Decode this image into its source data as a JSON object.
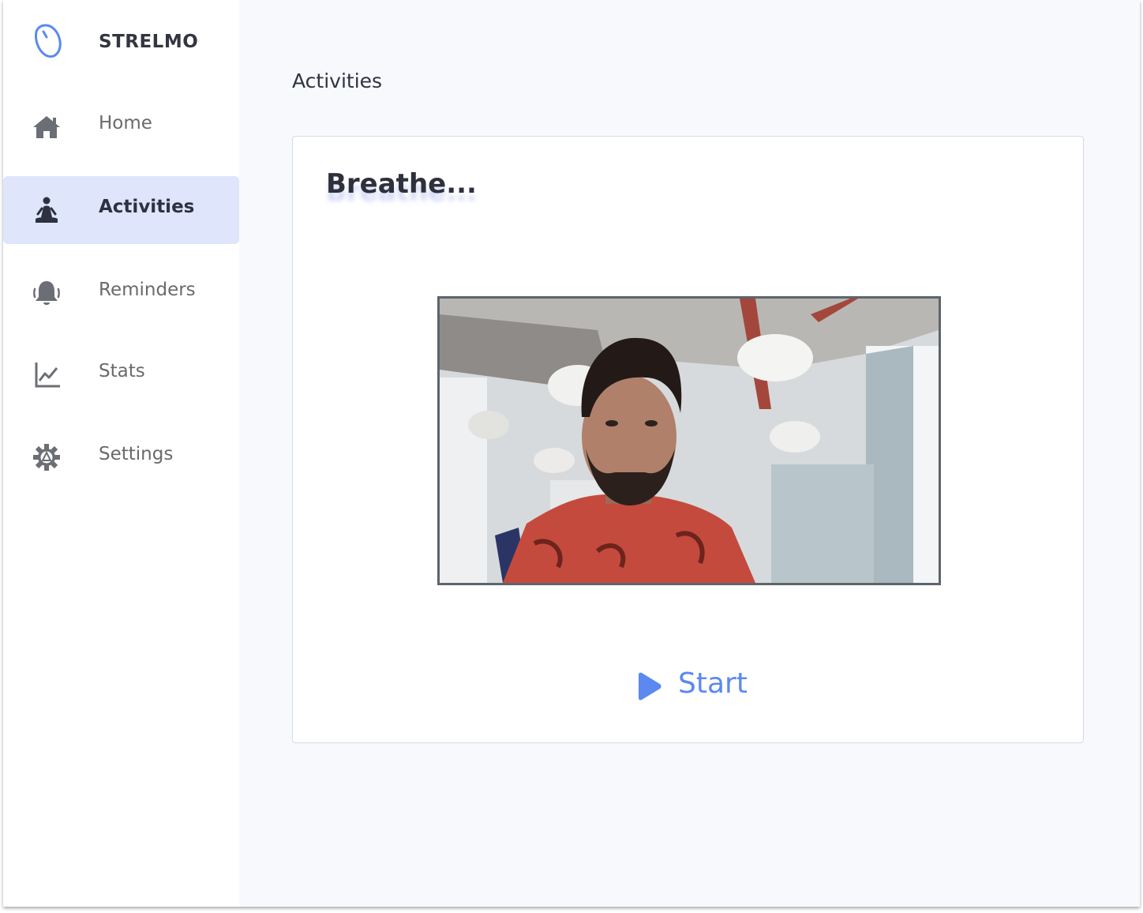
{
  "app": {
    "brand_name": "STRELMO",
    "logo_icon": "mouse-icon",
    "accent_color": "#5b89f0"
  },
  "sidebar": {
    "items": [
      {
        "label": "Home",
        "icon": "home-icon",
        "active": false
      },
      {
        "label": "Activities",
        "icon": "meditation-icon",
        "active": true
      },
      {
        "label": "Reminders",
        "icon": "bell-icon",
        "active": false
      },
      {
        "label": "Stats",
        "icon": "line-chart-icon",
        "active": false
      },
      {
        "label": "Settings",
        "icon": "gear-icon",
        "active": false
      }
    ]
  },
  "main": {
    "page_title": "Activities",
    "card": {
      "title": "Breathe...",
      "video": "webcam-feed",
      "start_label": "Start",
      "start_icon": "play-icon"
    }
  }
}
